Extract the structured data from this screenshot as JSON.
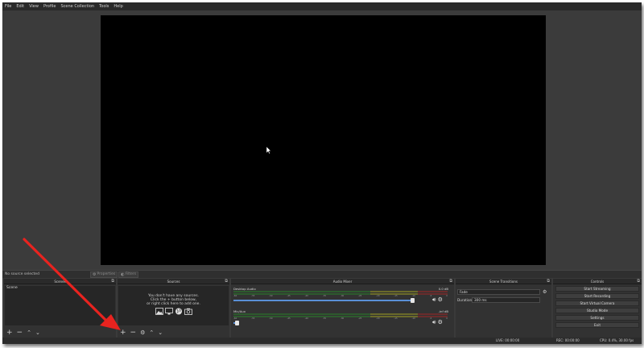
{
  "menu": [
    "File",
    "Edit",
    "View",
    "Profile",
    "Scene Collection",
    "Tools",
    "Help"
  ],
  "source_toolbar": {
    "no_source": "No source selected",
    "properties": "Properties",
    "filters": "Filters"
  },
  "scenes": {
    "title": "Scenes",
    "items": [
      "Scene"
    ]
  },
  "sources": {
    "title": "Sources",
    "empty_lines": [
      "You don't have any sources.",
      "Click the + button below,",
      "or right click here to add one."
    ]
  },
  "mixer": {
    "title": "Audio Mixer",
    "channels": [
      {
        "name": "Desktop Audio",
        "db": "0.0 dB",
        "level": 0.92
      },
      {
        "name": "Mic/Aux",
        "db": "-inf dB",
        "level": 0.02
      }
    ],
    "ticks": [
      "-60",
      "-55",
      "-50",
      "-45",
      "-40",
      "-35",
      "-30",
      "-25",
      "-20",
      "-15",
      "-10",
      "-5",
      "0"
    ]
  },
  "transitions": {
    "title": "Scene Transitions",
    "selected": "Fade",
    "duration_label": "Duration",
    "duration_value": "300 ms"
  },
  "controls": {
    "title": "Controls",
    "buttons": [
      "Start Streaming",
      "Start Recording",
      "Start Virtual Camera",
      "Studio Mode",
      "Settings",
      "Exit"
    ]
  },
  "status": {
    "live": "LIVE: 00:00:00",
    "rec": "REC: 00:00:00",
    "cpu": "CPU: 0.4%, 30.00 fps"
  },
  "colors": {
    "annotation_arrow": "#e8231f",
    "fader": "#5a8fd6",
    "canvas": "#000000"
  }
}
